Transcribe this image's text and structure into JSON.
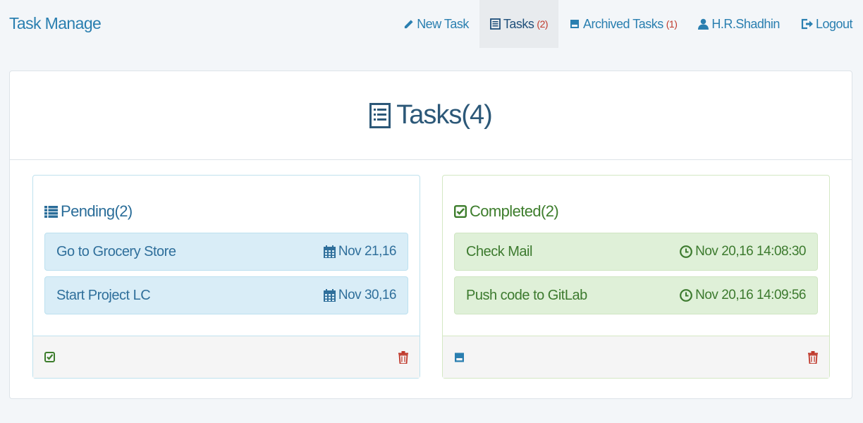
{
  "navbar": {
    "brand": "Task Manage",
    "items": [
      {
        "label": "New Task",
        "icon": "pencil-icon"
      },
      {
        "label": "Tasks",
        "count": "(2)",
        "icon": "list-alt-icon",
        "active": true
      },
      {
        "label": "Archived Tasks",
        "count": "(1)",
        "icon": "inbox-icon"
      },
      {
        "label": "H.R.Shadhin",
        "icon": "user-icon"
      },
      {
        "label": "Logout",
        "icon": "logout-icon"
      }
    ]
  },
  "main": {
    "title": "Tasks(4)",
    "title_icon": "list-alt-icon"
  },
  "pending": {
    "title": "Pending(2)",
    "icon": "list-icon",
    "tasks": [
      {
        "name": "Go to Grocery Store",
        "date": "Nov 21,16",
        "icon": "calendar-icon"
      },
      {
        "name": "Start Project LC",
        "date": "Nov 30,16",
        "icon": "calendar-icon"
      }
    ],
    "footer_left_icon": "check-square-icon",
    "footer_right_icon": "trash-icon"
  },
  "completed": {
    "title": "Completed(2)",
    "icon": "check-square-icon",
    "tasks": [
      {
        "name": "Check Mail",
        "date": "Nov 20,16 14:08:30",
        "icon": "clock-icon"
      },
      {
        "name": "Push code to GitLab",
        "date": "Nov 20,16 14:09:56",
        "icon": "clock-icon"
      }
    ],
    "footer_left_icon": "inbox-icon",
    "footer_right_icon": "trash-icon"
  },
  "colors": {
    "link": "#2a7fb0",
    "badge": "#c0392b",
    "pending_bg": "#d9edf7",
    "completed_bg": "#dff0d8",
    "danger": "#c0392b",
    "success": "#3d7d2c"
  }
}
